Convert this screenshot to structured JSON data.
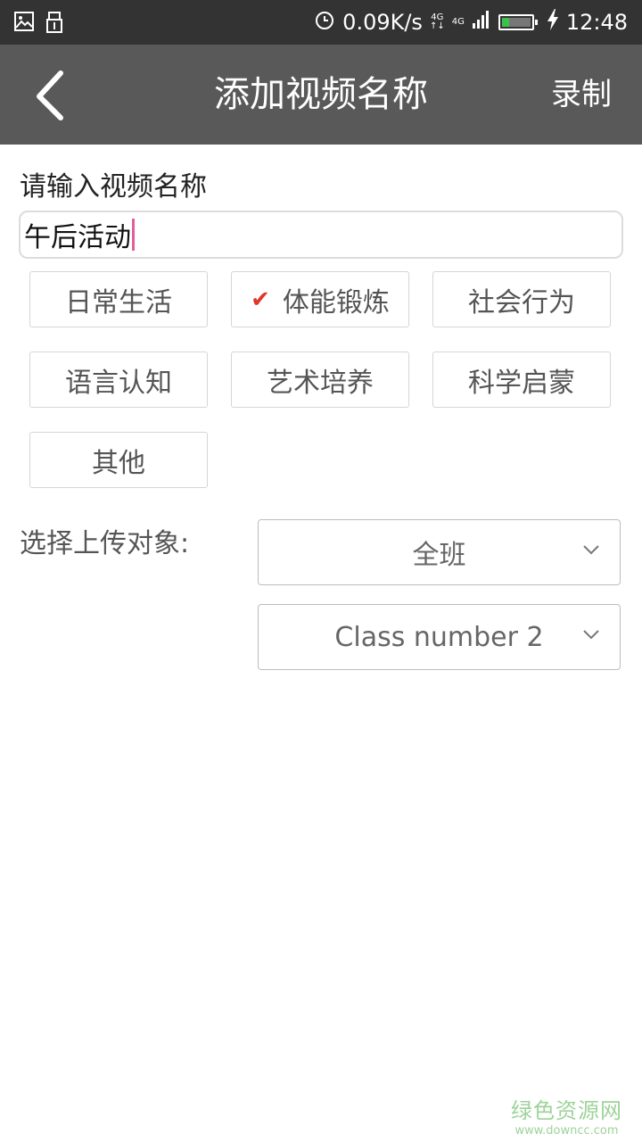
{
  "status_bar": {
    "left_icons": [
      "image-icon",
      "usb-icon"
    ],
    "alarm_icon": "alarm-icon",
    "net_speed": "0.09K/s",
    "network_labels": [
      "4G",
      "4G"
    ],
    "signal_icon": "signal-icon",
    "battery_icon": "battery-icon",
    "charging_icon": "charging-icon",
    "time": "12:48"
  },
  "app_bar": {
    "back_icon": "back-chevron-icon",
    "title": "添加视频名称",
    "action_label": "录制"
  },
  "form": {
    "name_label": "请输入视频名称",
    "name_value": "午后活动",
    "tags": [
      {
        "label": "日常生活",
        "selected": false
      },
      {
        "label": "体能锻炼",
        "selected": true
      },
      {
        "label": "社会行为",
        "selected": false
      },
      {
        "label": "语言认知",
        "selected": false
      },
      {
        "label": "艺术培养",
        "selected": false
      },
      {
        "label": "科学启蒙",
        "selected": false
      },
      {
        "label": "其他",
        "selected": false
      }
    ],
    "check_glyph": "✔",
    "target_label": "选择上传对象:",
    "target_selects": [
      {
        "value": "全班"
      },
      {
        "value": "Class number 2"
      }
    ]
  },
  "colors": {
    "app_bar_bg": "#595959",
    "status_bar_bg": "#333333",
    "check": "#e0352b",
    "caret": "#e0609a"
  },
  "watermark": {
    "name": "绿色资源网",
    "url": "www.downcc.com"
  }
}
